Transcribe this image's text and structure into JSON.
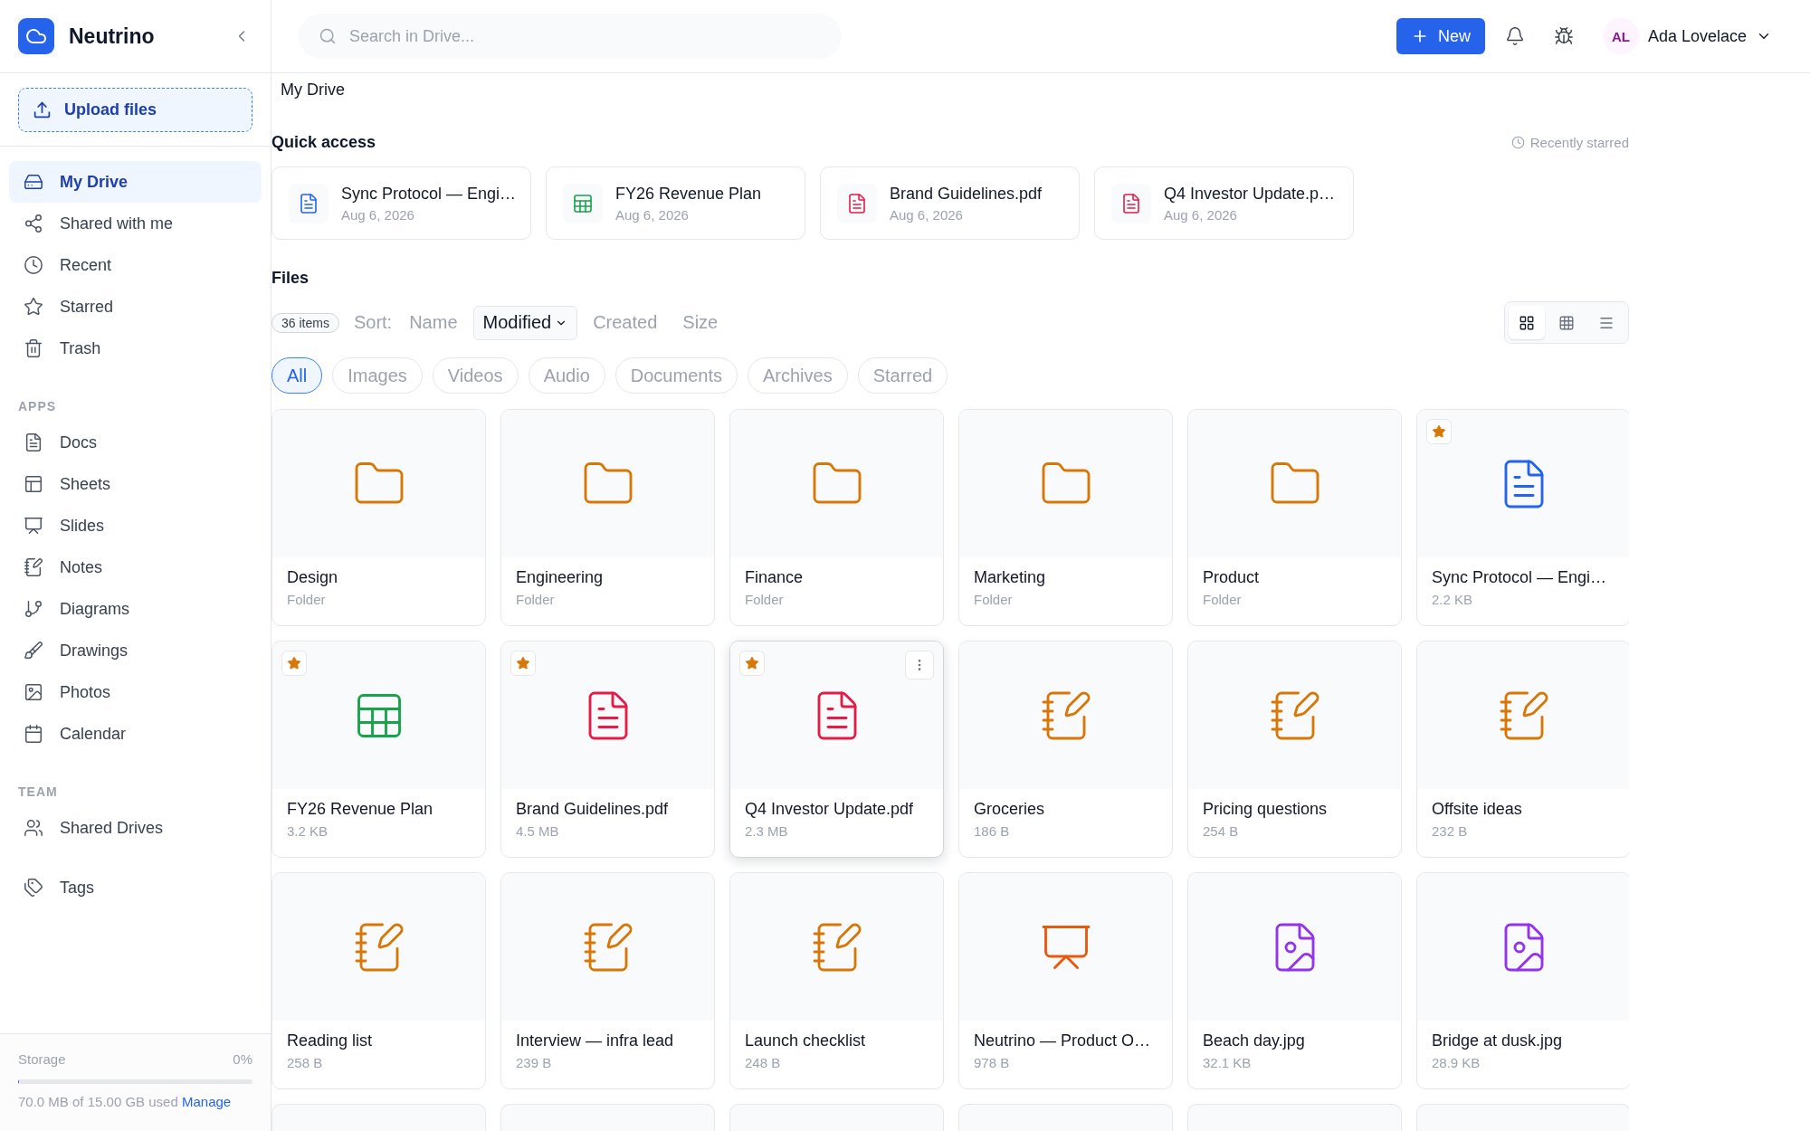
{
  "sidebar": {
    "brand": "Neutrino",
    "upload_button": "Upload files",
    "nav": [
      {
        "label": "My Drive",
        "kind": "drive",
        "selected": true
      },
      {
        "label": "Shared with me",
        "kind": "share",
        "selected": false
      },
      {
        "label": "Recent",
        "kind": "recent",
        "selected": false
      },
      {
        "label": "Starred",
        "kind": "starred",
        "selected": false
      },
      {
        "label": "Trash",
        "kind": "trash",
        "selected": false
      }
    ],
    "sections": [
      {
        "title": "APPS",
        "items": [
          {
            "label": "Docs",
            "kind": "docs",
            "selected": false
          },
          {
            "label": "Sheets",
            "kind": "sheets",
            "selected": false
          },
          {
            "label": "Slides",
            "kind": "slides",
            "selected": false
          },
          {
            "label": "Notes",
            "kind": "notes",
            "selected": false
          },
          {
            "label": "Diagrams",
            "kind": "diagrams",
            "selected": false
          },
          {
            "label": "Drawings",
            "kind": "drawings",
            "selected": false
          },
          {
            "label": "Photos",
            "kind": "photos",
            "selected": false
          },
          {
            "label": "Calendar",
            "kind": "calendar",
            "selected": false
          }
        ]
      },
      {
        "title": "TEAM",
        "items": [
          {
            "label": "Shared Drives",
            "kind": "team",
            "selected": false
          }
        ]
      },
      {
        "items": [
          {
            "label": "Tags",
            "kind": "tags",
            "selected": false
          }
        ]
      }
    ],
    "storage": {
      "label": "Storage",
      "percent": "0%",
      "level": 0.005,
      "usage": "70.0 MB of 15.00 GB used",
      "link": "Manage"
    }
  },
  "topbar": {
    "search": {
      "placeholder": "Search in Drive..."
    },
    "new_button": "New",
    "user": {
      "initials": "AL",
      "name": "Ada Lovelace"
    }
  },
  "breadcrumb": "My Drive",
  "quick_access": {
    "title": "Quick access",
    "hint": "Recently starred",
    "cards": [
      {
        "name": "Sync Protocol — Engi…",
        "date": "Aug 6, 2026",
        "kind": "doc"
      },
      {
        "name": "FY26 Revenue Plan",
        "date": "Aug 6, 2026",
        "kind": "sheet"
      },
      {
        "name": "Brand Guidelines.pdf",
        "date": "Aug 6, 2026",
        "kind": "pdf"
      },
      {
        "name": "Q4 Investor Update.p…",
        "date": "Aug 6, 2026",
        "kind": "pdf"
      }
    ]
  },
  "files": {
    "title": "Files",
    "count": "36 items",
    "sort_label": "Sort:",
    "sort_options": [
      {
        "label": "Name",
        "selected": false
      },
      {
        "label": "Modified",
        "selected": true
      },
      {
        "label": "Created",
        "selected": false
      },
      {
        "label": "Size",
        "selected": false
      }
    ],
    "views": [
      {
        "kind": "grid",
        "selected": true
      },
      {
        "kind": "table",
        "selected": false
      },
      {
        "kind": "list",
        "selected": false
      }
    ],
    "filters": [
      {
        "label": "All",
        "selected": true
      },
      {
        "label": "Images",
        "selected": false
      },
      {
        "label": "Videos",
        "selected": false
      },
      {
        "label": "Audio",
        "selected": false
      },
      {
        "label": "Documents",
        "selected": false
      },
      {
        "label": "Archives",
        "selected": false
      },
      {
        "label": "Starred",
        "selected": false
      }
    ],
    "items": [
      {
        "name": "Design",
        "meta": "Folder",
        "kind": "folder",
        "starred": false,
        "hovered": false
      },
      {
        "name": "Engineering",
        "meta": "Folder",
        "kind": "folder",
        "starred": false,
        "hovered": false
      },
      {
        "name": "Finance",
        "meta": "Folder",
        "kind": "folder",
        "starred": false,
        "hovered": false
      },
      {
        "name": "Marketing",
        "meta": "Folder",
        "kind": "folder",
        "starred": false,
        "hovered": false
      },
      {
        "name": "Product",
        "meta": "Folder",
        "kind": "folder",
        "starred": false,
        "hovered": false
      },
      {
        "name": "Sync Protocol — Engi…",
        "meta": "2.2 KB",
        "kind": "doc",
        "starred": true,
        "hovered": false
      },
      {
        "name": "FY26 Revenue Plan",
        "meta": "3.2 KB",
        "kind": "sheet",
        "starred": true,
        "hovered": false
      },
      {
        "name": "Brand Guidelines.pdf",
        "meta": "4.5 MB",
        "kind": "pdf",
        "starred": true,
        "hovered": false
      },
      {
        "name": "Q4 Investor Update.pdf",
        "meta": "2.3 MB",
        "kind": "pdf",
        "starred": true,
        "hovered": true
      },
      {
        "name": "Groceries",
        "meta": "186 B",
        "kind": "note",
        "starred": false,
        "hovered": false
      },
      {
        "name": "Pricing questions",
        "meta": "254 B",
        "kind": "note",
        "starred": false,
        "hovered": false
      },
      {
        "name": "Offsite ideas",
        "meta": "232 B",
        "kind": "note",
        "starred": false,
        "hovered": false
      },
      {
        "name": "Reading list",
        "meta": "258 B",
        "kind": "note",
        "starred": false,
        "hovered": false
      },
      {
        "name": "Interview — infra lead",
        "meta": "239 B",
        "kind": "note",
        "starred": false,
        "hovered": false
      },
      {
        "name": "Launch checklist",
        "meta": "248 B",
        "kind": "note",
        "starred": false,
        "hovered": false
      },
      {
        "name": "Neutrino — Product O…",
        "meta": "978 B",
        "kind": "slides",
        "starred": false,
        "hovered": false
      },
      {
        "name": "Beach day.jpg",
        "meta": "32.1 KB",
        "kind": "image",
        "starred": false,
        "hovered": false
      },
      {
        "name": "Bridge at dusk.jpg",
        "meta": "28.9 KB",
        "kind": "image",
        "starred": false,
        "hovered": false
      },
      {
        "kind": "cut_off"
      },
      {
        "kind": "cut_off"
      },
      {
        "kind": "cut_off"
      },
      {
        "kind": "cut_off"
      },
      {
        "kind": "cut_off"
      },
      {
        "kind": "cut_off"
      }
    ]
  }
}
